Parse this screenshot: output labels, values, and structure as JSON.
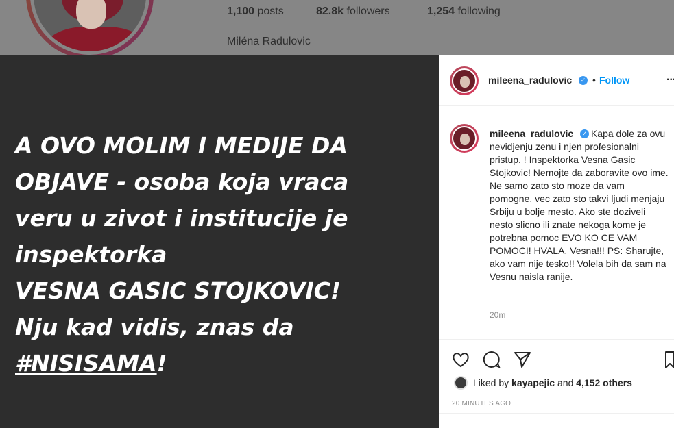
{
  "profile": {
    "posts_count": "1,100",
    "posts_label": "posts",
    "followers_count": "82.8k",
    "followers_label": "followers",
    "following_count": "1,254",
    "following_label": "following",
    "display_name": "Miléna Radulovic"
  },
  "story": {
    "lines": [
      "A OVO MOLIM I MEDIJE DA",
      "OBJAVE - osoba koja vraca",
      "veru u zivot i institucije je",
      "inspektorka",
      "VESNA GASIC STOJKOVIC!",
      "Nju kad vidis, znas da"
    ],
    "hashtag": "#NISISAMA",
    "hashtag_suffix": "!"
  },
  "post": {
    "username": "mileena_radulovic",
    "follow_separator": "•",
    "follow_label": "Follow",
    "more_label": "...",
    "caption_user": "mileena_radulovic",
    "caption_text": "Kapa dole za ovu nevidjenju zenu i njen profesionalni pristup. ! Inspektorka Vesna Gasic Stojkovic! Nemojte da zaboravite ovo ime. Ne samo zato sto moze da vam pomogne, vec zato sto takvi ljudi menjaju Srbiju u bolje mesto. Ako ste doziveli nesto slicno ili znate nekoga kome je potrebna pomoc EVO KO CE VAM POMOCI! HVALA, Vesna!!! PS: Sharujte, ako vam nije tesko!! Volela bih da sam na Vesnu naisla ranije.",
    "caption_time": "20m",
    "liked_by_prefix": "Liked by",
    "liked_by_user": "kayapejic",
    "liked_by_and": "and",
    "liked_by_others": "4,152 others",
    "posted_ago": "20 MINUTES AGO",
    "icons": [
      "heart-icon",
      "comment-icon",
      "share-icon",
      "bookmark-icon"
    ]
  },
  "colors": {
    "accent_blue": "#0095f6",
    "story_background": "#2d2d2d",
    "overlay_gray": "#868686"
  }
}
